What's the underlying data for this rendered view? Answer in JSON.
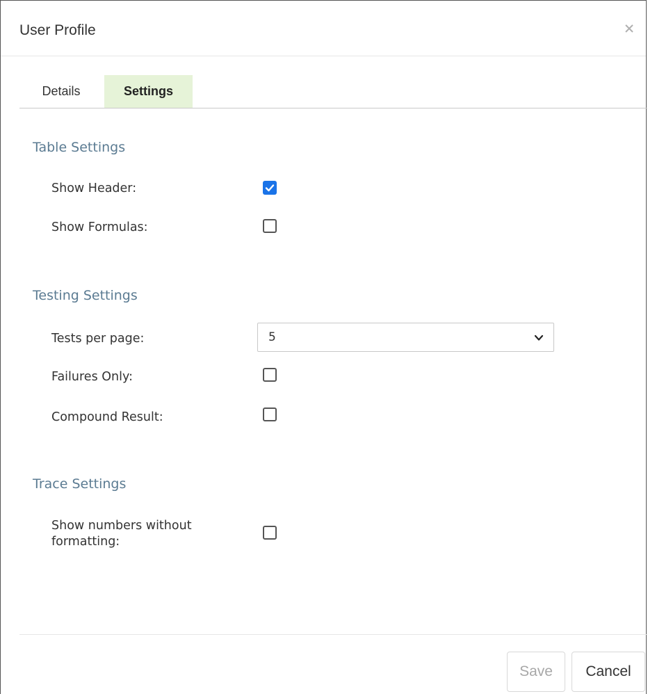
{
  "dialog": {
    "title": "User Profile",
    "close_icon": "close-icon"
  },
  "tabs": [
    {
      "label": "Details",
      "active": false
    },
    {
      "label": "Settings",
      "active": true
    }
  ],
  "sections": {
    "table": {
      "title": "Table Settings",
      "show_header": {
        "label": "Show Header:",
        "checked": true
      },
      "show_formulas": {
        "label": "Show Formulas:",
        "checked": false
      }
    },
    "testing": {
      "title": "Testing Settings",
      "tests_per_page": {
        "label": "Tests per page:",
        "value": "5"
      },
      "failures_only": {
        "label": "Failures Only:",
        "checked": false
      },
      "compound_result": {
        "label": "Compound Result:",
        "checked": false
      }
    },
    "trace": {
      "title": "Trace Settings",
      "show_numbers_line1": "Show numbers without",
      "show_numbers_line2": "formatting:",
      "show_numbers_checked": false
    }
  },
  "footer": {
    "save_label": "Save",
    "cancel_label": "Cancel"
  },
  "colors": {
    "active_tab_bg": "#e6f3d8",
    "section_title": "#5b7b92",
    "checkbox_checked": "#1a73e8"
  }
}
